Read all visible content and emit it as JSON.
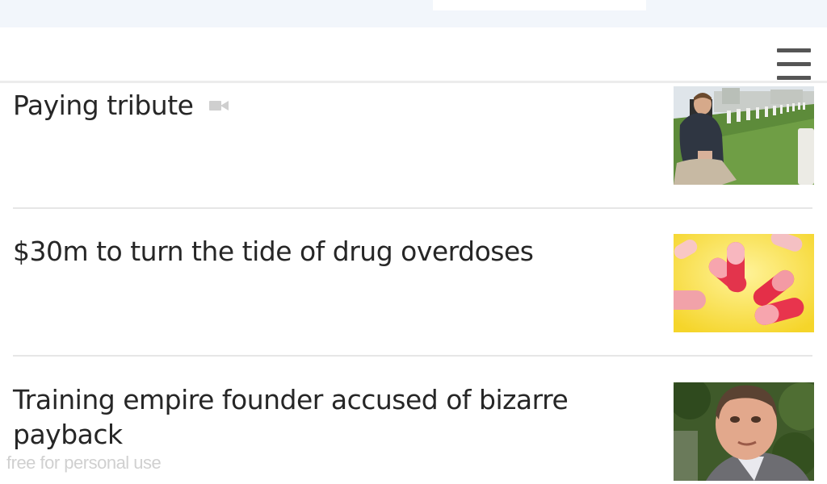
{
  "header": {
    "menu_icon": "hamburger-menu-icon"
  },
  "stories": [
    {
      "headline": "Paying tribute",
      "has_video": true,
      "video_icon": "video-camera-icon",
      "thumbnail": "man kneeling at war cemetery headstones"
    },
    {
      "headline": "$30m to turn the tide of drug overdoses",
      "has_video": false,
      "thumbnail": "red and white capsules on yellow background"
    },
    {
      "headline": "Training empire founder accused of bizarre payback",
      "has_video": false,
      "thumbnail": "portrait of man in suit"
    }
  ],
  "watermark": "free for personal use",
  "colors": {
    "headline_text": "#262626",
    "divider": "#e6e6e6",
    "menu_icon": "#555555",
    "status_strip": "#f2f6fb",
    "thumb_yellow": "#f7df3d",
    "capsule_red": "#e8344d"
  }
}
